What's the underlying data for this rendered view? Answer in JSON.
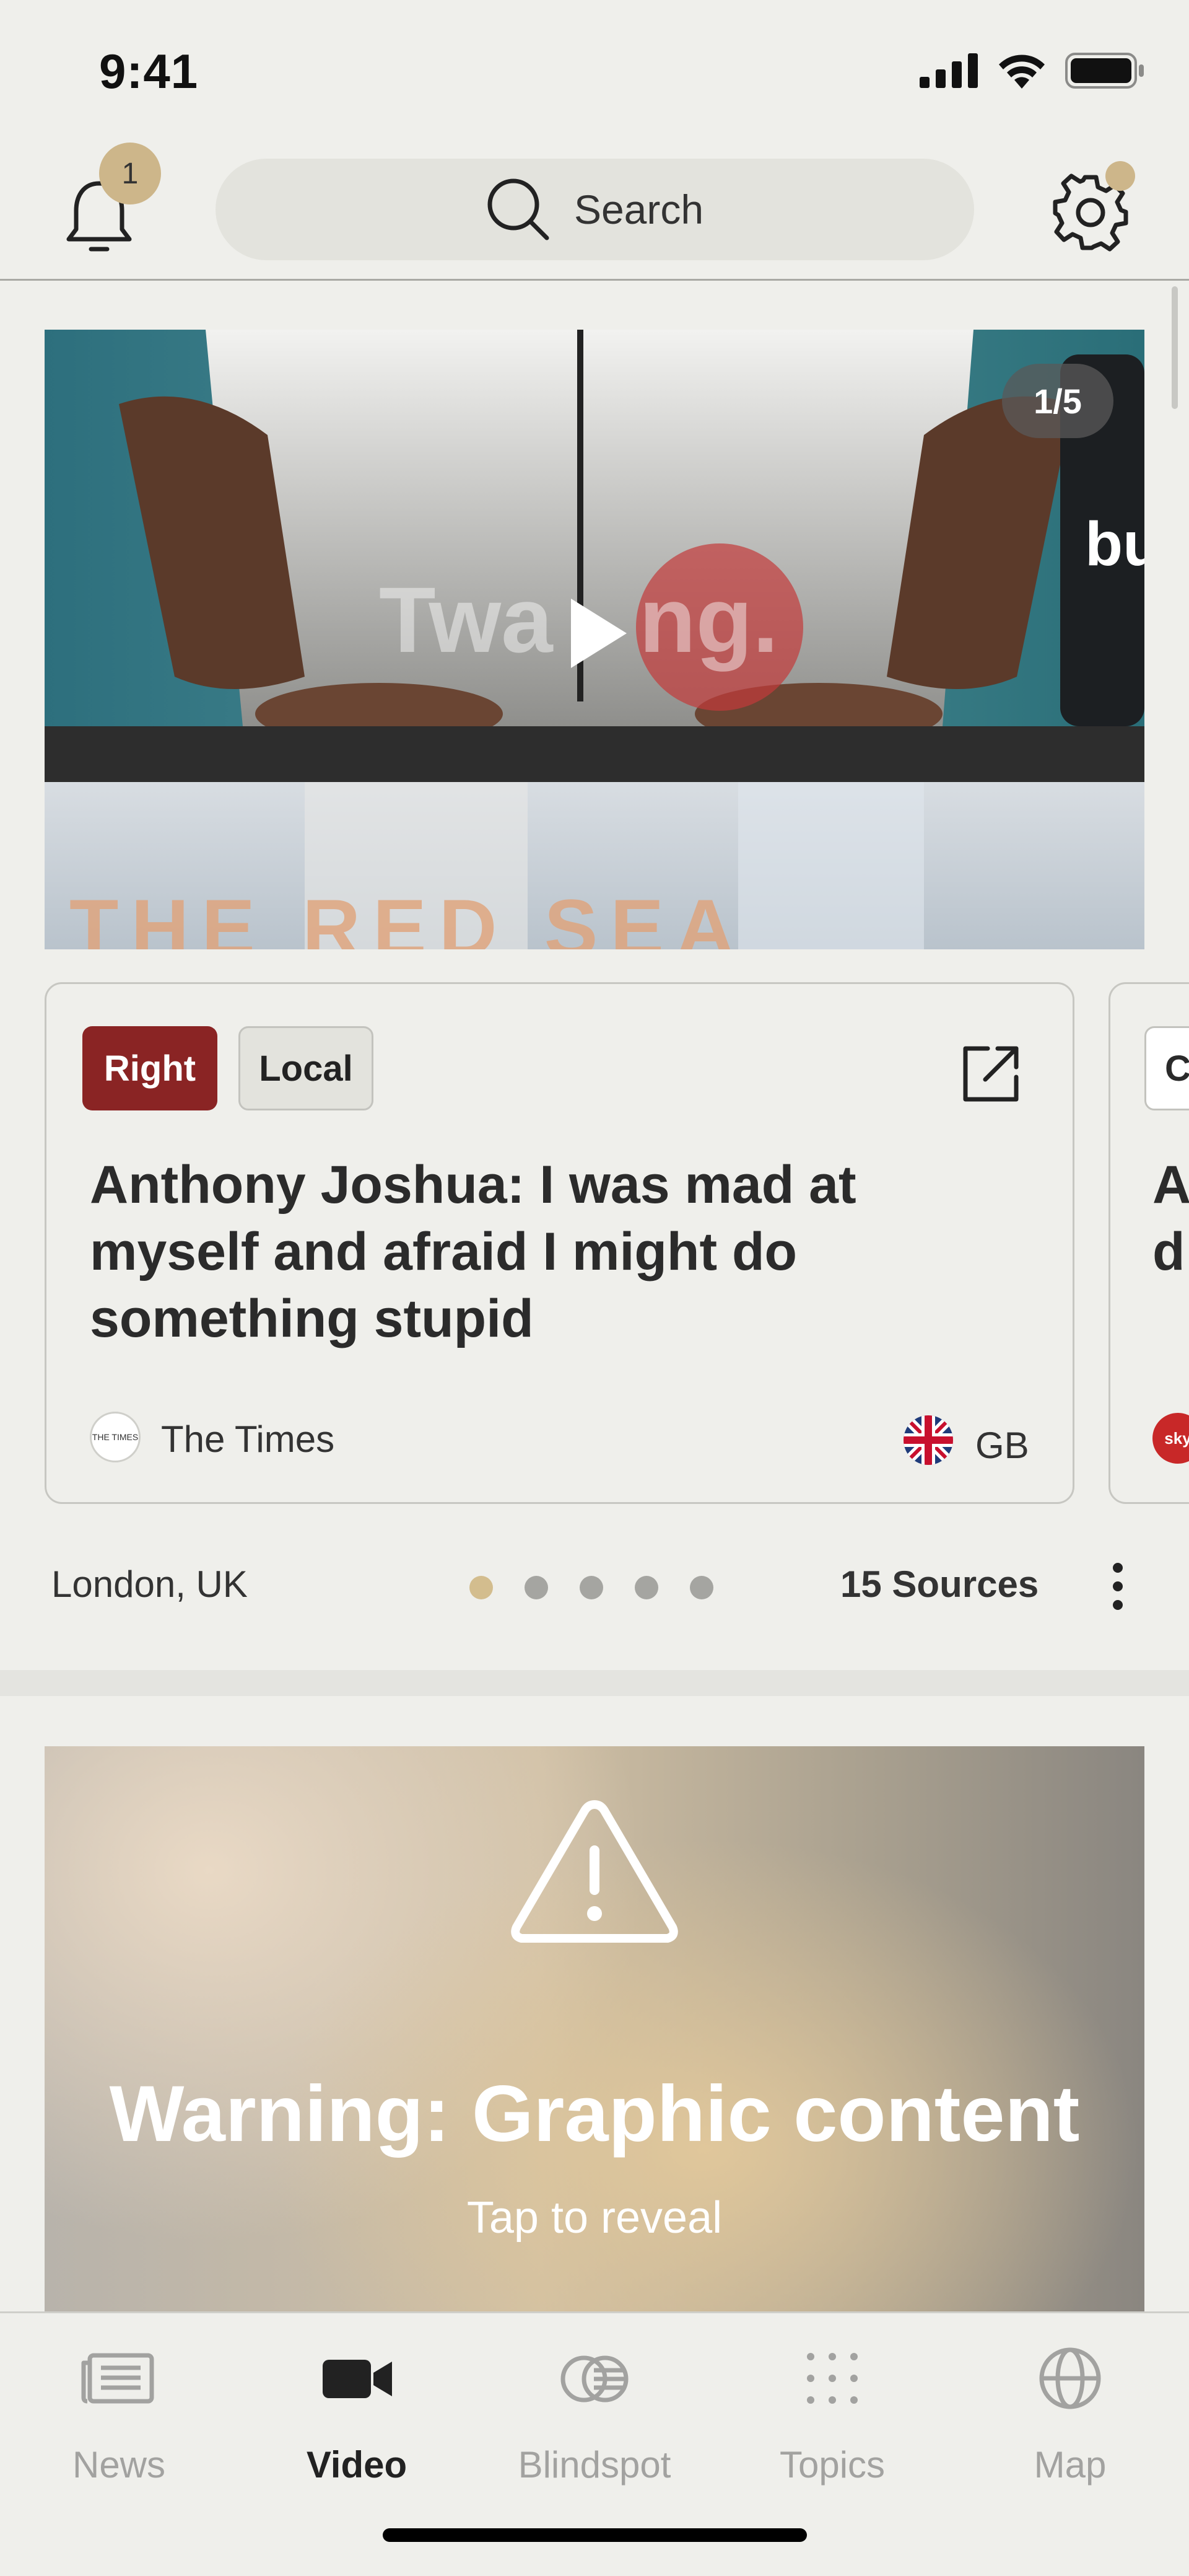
{
  "status": {
    "time": "9:41"
  },
  "header": {
    "notification_count": "1",
    "search_label": "Search"
  },
  "hero": {
    "counter": "1/5"
  },
  "article": {
    "tags": [
      "Right",
      "Local"
    ],
    "headline": "Anthony Joshua: I was mad at myself and afraid I might do something stupid",
    "source_name": "The Times",
    "source_logo_text": "THE TIMES",
    "country": "GB"
  },
  "next_article": {
    "tag": "C",
    "headline_partial": "A\nd",
    "source_logo_text": "sky"
  },
  "card_footer": {
    "location": "London, UK",
    "page_count": 5,
    "active_page": 0,
    "sources": "15 Sources"
  },
  "warning": {
    "title": "Warning: Graphic content",
    "subtitle": "Tap to reveal"
  },
  "tabbar": {
    "tabs": [
      {
        "label": "News",
        "icon": "news-icon",
        "active": false
      },
      {
        "label": "Video",
        "icon": "video-camera-icon",
        "active": true
      },
      {
        "label": "Blindspot",
        "icon": "blindspot-icon",
        "active": false
      },
      {
        "label": "Topics",
        "icon": "grid-dots-icon",
        "active": false
      },
      {
        "label": "Map",
        "icon": "globe-icon",
        "active": false
      }
    ]
  },
  "colors": {
    "accent": "#cdb68a",
    "right_tag": "#8a2424",
    "background": "#efefeb"
  }
}
